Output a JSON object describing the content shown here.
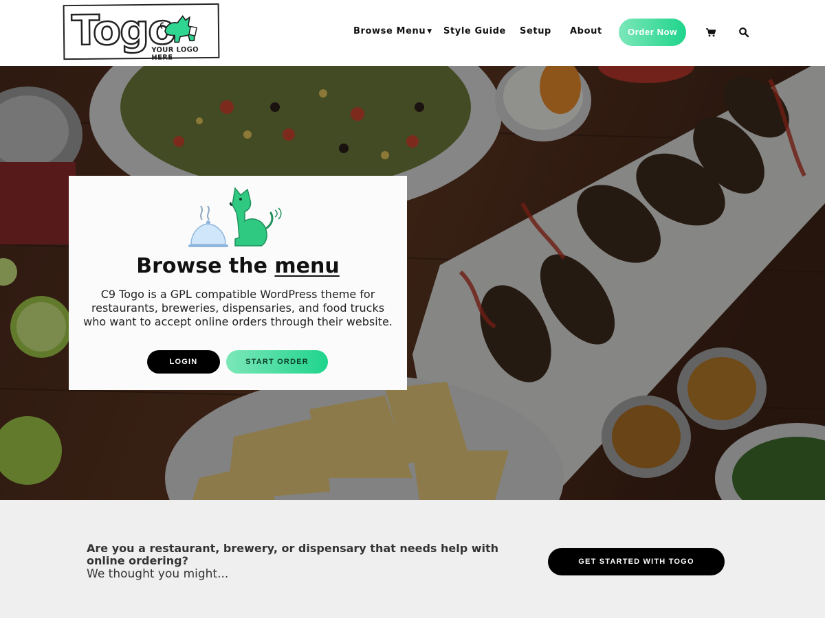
{
  "logo": {
    "wordmark": "Togo",
    "tagline": "YOUR LOGO HERE"
  },
  "nav": {
    "browse_menu": "Browse Menu",
    "style_guide": "Style Guide",
    "setup": "Setup",
    "about": "About",
    "order_now": "Order Now",
    "icons": [
      "cart-icon",
      "search-icon"
    ]
  },
  "hero": {
    "title_prefix": "Browse the",
    "title_link": "menu",
    "description": "C9 Togo is a GPL compatible WordPress theme for restaurants, breweries, dispensaries, and food trucks who want to accept online orders through their website.",
    "login_label": "LOGIN",
    "start_order_label": "START ORDER"
  },
  "cta": {
    "headline": "Are you a restaurant, brewery, or dispensary that needs help with online ordering?",
    "subtext": "We thought you might...",
    "button_label": "GET STARTED WITH TOGO"
  },
  "colors": {
    "accent_start": "#7ce7b9",
    "accent_end": "#1fd48c",
    "dark": "#000000",
    "band": "#efefef"
  }
}
